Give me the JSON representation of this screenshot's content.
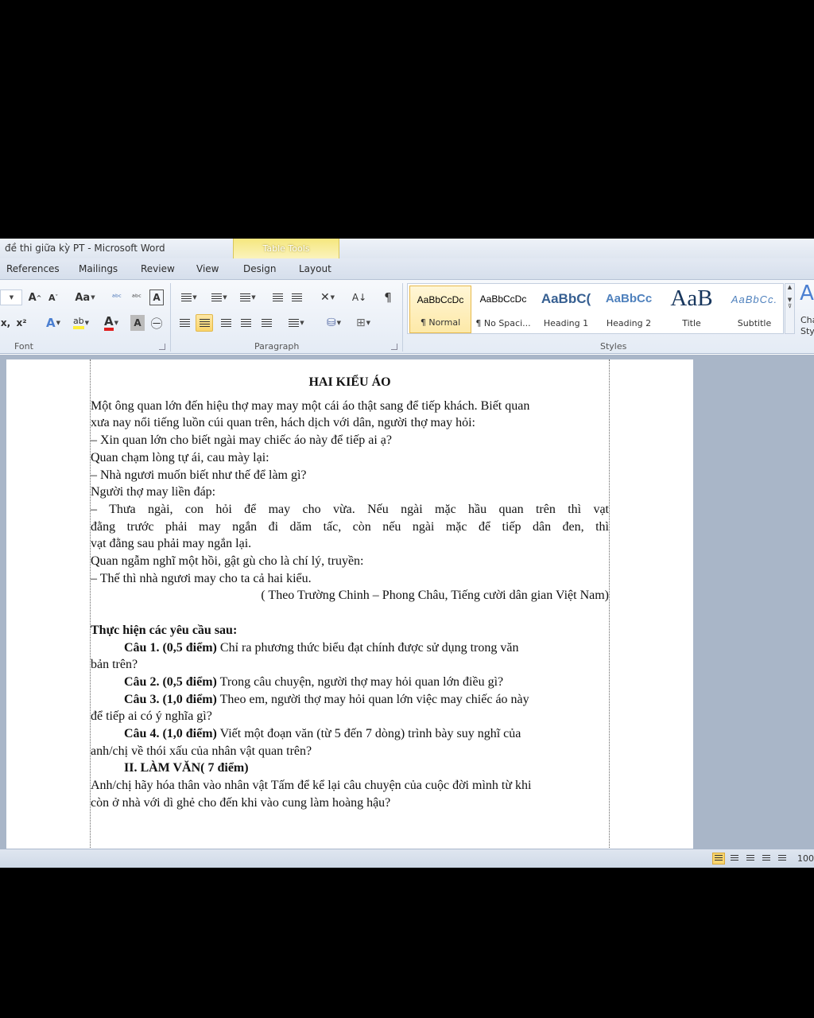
{
  "window": {
    "title": "đề thi giữa kỳ PT  -  Microsoft Word",
    "contextual_tab_group": "Table Tools"
  },
  "tabs": [
    "References",
    "Mailings",
    "Review",
    "View",
    "Design",
    "Layout"
  ],
  "ribbon": {
    "groups": {
      "font": "Font",
      "paragraph": "Paragraph",
      "styles": "Styles"
    },
    "font": {
      "grow": "A",
      "shrink": "A",
      "change_case": "Aa",
      "clear": "A",
      "subscript": "x,",
      "superscript": "x²",
      "highlight": "ab",
      "font_color": "A",
      "char_shading": "A"
    },
    "paragraph": {
      "pilcrow": "¶",
      "sort": "A↓"
    },
    "styles": [
      {
        "preview": "AaBbCcDc",
        "name": "¶ Normal"
      },
      {
        "preview": "AaBbCcDc",
        "name": "¶ No Spaci..."
      },
      {
        "preview": "AaBbC(",
        "name": "Heading 1"
      },
      {
        "preview": "AaBbCc",
        "name": "Heading 2"
      },
      {
        "preview": "AaB",
        "name": "Title"
      },
      {
        "preview": "AaBbCc.",
        "name": "Subtitle"
      }
    ],
    "change_styles": {
      "preview": "A",
      "line1": "Cha",
      "line2": "Sty"
    }
  },
  "document": {
    "heading": "HAI KIỂU ÁO",
    "story": [
      "Một ông quan lớn đến hiệu thợ may may một cái áo thật sang để tiếp khách. Biết quan",
      "xưa nay nổi tiếng luồn cúi quan trên, hách dịch với dân, người thợ may hỏi:",
      "– Xin quan lớn cho biết ngài may chiếc áo này để tiếp ai ạ?",
      "Quan chạm lòng tự ái, cau mày lại:",
      "– Nhà ngươi muốn biết như thế để làm gì?",
      "Người thợ may liền đáp:"
    ],
    "story_just": [
      "– Thưa ngài, con hỏi để may cho vừa. Nếu ngài mặc hầu quan trên thì vạt",
      "đằng trước phải may ngắn đi dăm tấc, còn nếu ngài mặc để tiếp dân đen, thì"
    ],
    "story_end": [
      "vạt đằng sau phải may ngắn lại.",
      "Quan ngẫm nghĩ một hồi, gật gù cho là chí lý, truyền:",
      "– Thế thì nhà ngươi may cho ta cả hai kiểu."
    ],
    "source": "( Theo Trường Chinh – Phong Châu, Tiếng cười dân gian Việt Nam)",
    "requirements": "Thực hiện các yêu cầu sau:",
    "q1_label": "Câu 1. (0,5 điểm)",
    "q1_text": " Chỉ ra phương thức biểu đạt chính được sử dụng trong văn",
    "q1_cont": "bản trên?",
    "q2_label": "Câu 2. (0,5 điểm)",
    "q2_text": " Trong câu chuyện, người thợ may hỏi quan lớn điều gì?",
    "q3_label": "Câu 3. (1,0 điểm)",
    "q3_text": " Theo em, người thợ may hỏi quan lớn việc may chiếc áo này",
    "q3_cont": "để tiếp ai có ý nghĩa gì?",
    "q4_label": "Câu 4. (1,0 điểm)",
    "q4_text": " Viết một đoạn văn (từ 5 đến 7 dòng) trình bày suy nghĩ của",
    "q4_cont": "anh/chị về thói xấu của nhân vật quan trên?",
    "part2": "II. LÀM VĂN( 7 điểm)",
    "essay": [
      "Anh/chị hãy hóa thân vào nhân vật Tấm để kể lại câu chuyện của cuộc đời mình từ khi",
      "còn ở nhà với dì ghẻ cho đến khi vào cung làm hoàng hậu?"
    ]
  },
  "statusbar": {
    "zoom": "100"
  },
  "colors": {
    "selected_style": "#fde9a8",
    "contextual_tab": "#f5e77e",
    "heading1": "#365f91",
    "title": "#17365d"
  }
}
